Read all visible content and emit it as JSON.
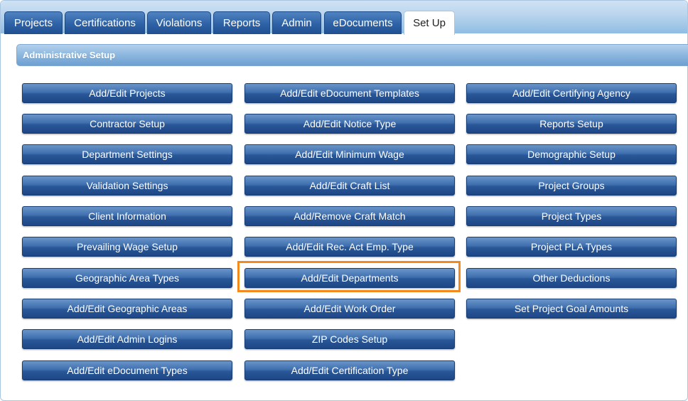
{
  "tabs": [
    {
      "label": "Projects",
      "active": false
    },
    {
      "label": "Certifications",
      "active": false
    },
    {
      "label": "Violations",
      "active": false
    },
    {
      "label": "Reports",
      "active": false
    },
    {
      "label": "Admin",
      "active": false
    },
    {
      "label": "eDocuments",
      "active": false
    },
    {
      "label": "Set Up",
      "active": true
    }
  ],
  "section": {
    "title": "Administrative Setup"
  },
  "columns": [
    [
      "Add/Edit Projects",
      "Contractor Setup",
      "Department Settings",
      "Validation Settings",
      "Client Information",
      "Prevailing Wage Setup",
      "Geographic Area Types",
      "Add/Edit Geographic Areas",
      "Add/Edit Admin Logins",
      "Add/Edit eDocument Types"
    ],
    [
      "Add/Edit eDocument Templates",
      "Add/Edit Notice Type",
      "Add/Edit Minimum Wage",
      "Add/Edit Craft List",
      "Add/Remove Craft Match",
      "Add/Edit Rec. Act Emp. Type",
      "Add/Edit Departments",
      "Add/Edit Work Order",
      "ZIP Codes Setup",
      "Add/Edit Certification Type"
    ],
    [
      "Add/Edit Certifying Agency",
      "Reports Setup",
      "Demographic Setup",
      "Project Groups",
      "Project Types",
      "Project PLA Types",
      "Other Deductions",
      "Set Project Goal Amounts"
    ]
  ],
  "highlighted_button": "Add/Edit Departments",
  "colors": {
    "highlight": "#f28a1e",
    "button": "#2a5798",
    "tab": "#2e62a6"
  }
}
